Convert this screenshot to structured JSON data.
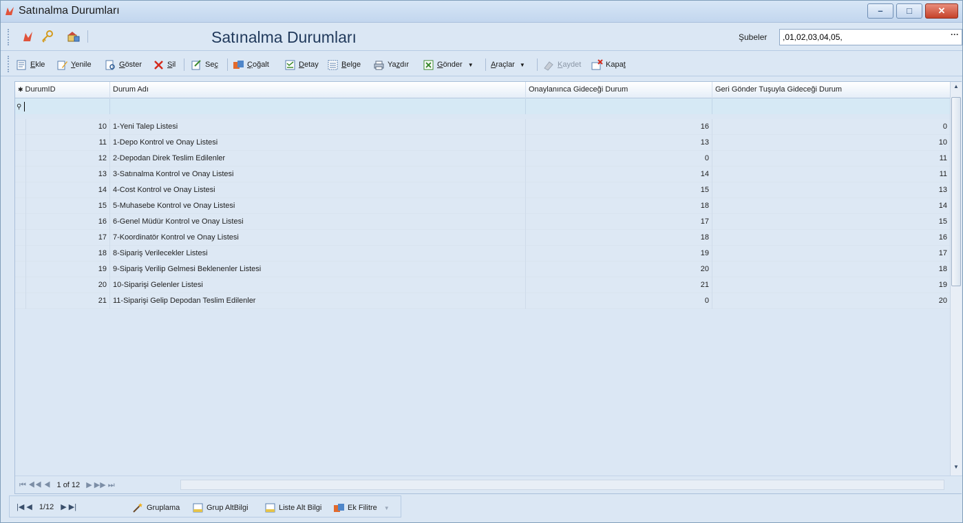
{
  "window": {
    "title": "Satınalma Durumları",
    "minimize": "–",
    "maximize": "□",
    "close": "✕"
  },
  "header": {
    "title": "Satınalma Durumları",
    "subeler_label": "Şubeler",
    "subeler_value": ",01,02,03,04,05,",
    "subeler_button": "···"
  },
  "toolbar": {
    "ekle": {
      "text": "kle",
      "hot": "E"
    },
    "yenile": {
      "text": "enile",
      "hot": "Y"
    },
    "goster": {
      "text": "öster",
      "hot": "G"
    },
    "sil": {
      "text": "il",
      "hot": "S"
    },
    "sec": {
      "pre": "Se",
      "hot": "ç"
    },
    "cogalt": {
      "text": "oğalt",
      "hot": "Ç"
    },
    "detay": {
      "text": "etay",
      "hot": "D"
    },
    "belge": {
      "text": "elge",
      "hot": "B"
    },
    "yazdir": {
      "pre": "Ya",
      "hot": "z",
      "post": "dır"
    },
    "gonder": {
      "text": "önder",
      "hot": "G"
    },
    "araclar": {
      "text": "raçlar",
      "hot": "A"
    },
    "kaydet": {
      "text": "aydet",
      "hot": "K"
    },
    "kapat": {
      "pre": "Kapa",
      "hot": "t"
    }
  },
  "grid": {
    "columns": [
      "DurumID",
      "Durum Adı",
      "Onaylanınca Gideceği Durum",
      "Geri Gönder Tuşuyla Gideceği Durum"
    ],
    "header_marker": "✱",
    "filter_marker": "⚲",
    "rows": [
      {
        "id": "10",
        "name": "1-Yeni Talep Listesi",
        "approve": "16",
        "back": "0"
      },
      {
        "id": "11",
        "name": "1-Depo Kontrol ve Onay Listesi",
        "approve": "13",
        "back": "10"
      },
      {
        "id": "12",
        "name": "2-Depodan Direk Teslim Edilenler",
        "approve": "0",
        "back": "11"
      },
      {
        "id": "13",
        "name": "3-Satınalma Kontrol ve Onay Listesi",
        "approve": "14",
        "back": "11"
      },
      {
        "id": "14",
        "name": "4-Cost Kontrol ve Onay Listesi",
        "approve": "15",
        "back": "13"
      },
      {
        "id": "15",
        "name": "5-Muhasebe Kontrol ve Onay Listesi",
        "approve": "18",
        "back": "14"
      },
      {
        "id": "16",
        "name": "6-Genel Müdür Kontrol ve Onay Listesi",
        "approve": "17",
        "back": "15"
      },
      {
        "id": "17",
        "name": "7-Koordinatör Kontrol ve Onay Listesi",
        "approve": "18",
        "back": "16"
      },
      {
        "id": "18",
        "name": "8-Sipariş Verilecekler Listesi",
        "approve": "19",
        "back": "17"
      },
      {
        "id": "19",
        "name": "9-Sipariş Verilip Gelmesi Beklenenler Listesi",
        "approve": "20",
        "back": "18"
      },
      {
        "id": "20",
        "name": "10-Siparişi Gelenler Listesi",
        "approve": "21",
        "back": "19"
      },
      {
        "id": "21",
        "name": "11-Siparişi Gelip Depodan Teslim Edilenler",
        "approve": "0",
        "back": "20"
      }
    ]
  },
  "navigator": {
    "nav_left": "⏮ ◀◀ ◀",
    "record": "1 of 12",
    "nav_right": "▶ ▶▶ ⏭"
  },
  "bottombar": {
    "nav_left": "|◀  ◀",
    "record": "1/12",
    "nav_right": "▶  ▶|",
    "gruplama": "Gruplama",
    "grup_altbilgi": "Grup AltBilgi",
    "liste_alt_bilgi": "Liste Alt Bilgi",
    "ek_filtre": "Ek Filitre"
  },
  "colors": {
    "accent": "#213a5c",
    "row_bg": "#dde8f4",
    "filter_bg": "#d6e9f5"
  }
}
